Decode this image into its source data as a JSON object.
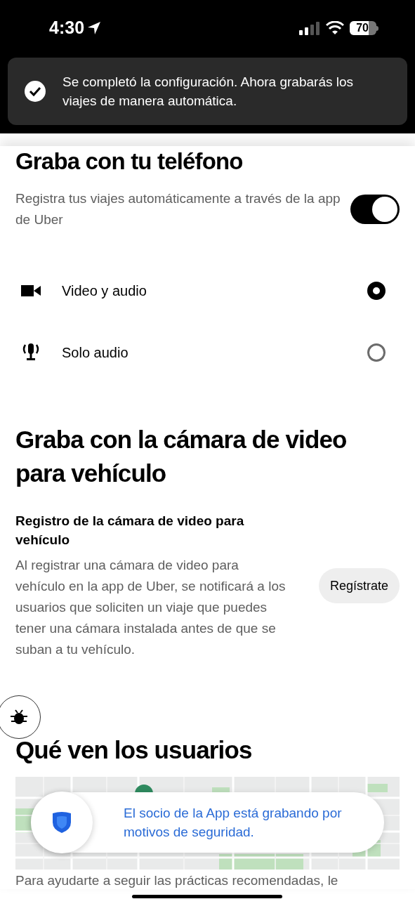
{
  "status_bar": {
    "time": "4:30",
    "battery": "70"
  },
  "toast": {
    "message": "Se completó la configuración. Ahora grabarás los viajes de manera automática."
  },
  "phone_section": {
    "title": "Graba con tu teléfono",
    "description": "Registra tus viajes automáticamente a través de la app de Uber",
    "toggle_on": true,
    "options": [
      {
        "kind": "video",
        "label": "Video y audio",
        "selected": true
      },
      {
        "kind": "audio",
        "label": "Solo audio",
        "selected": false
      }
    ]
  },
  "dashcam_section": {
    "title": "Graba con la cámara de video para vehículo",
    "subtitle": "Registro de la cámara de video para vehículo",
    "description": "Al registrar una cámara de video para vehículo en la app de Uber, se notificará a los usuarios que soliciten un viaje que puedes tener una cámara instalada antes de que se suban a tu vehículo.",
    "button": "Regístrate"
  },
  "users_section": {
    "title": "Qué ven los usuarios",
    "preview": {
      "kind": "picture",
      "banner": "El socio de la App está grabando por motivos de seguridad."
    },
    "footer": "Para ayudarte a seguir las prácticas recomendadas, le"
  }
}
